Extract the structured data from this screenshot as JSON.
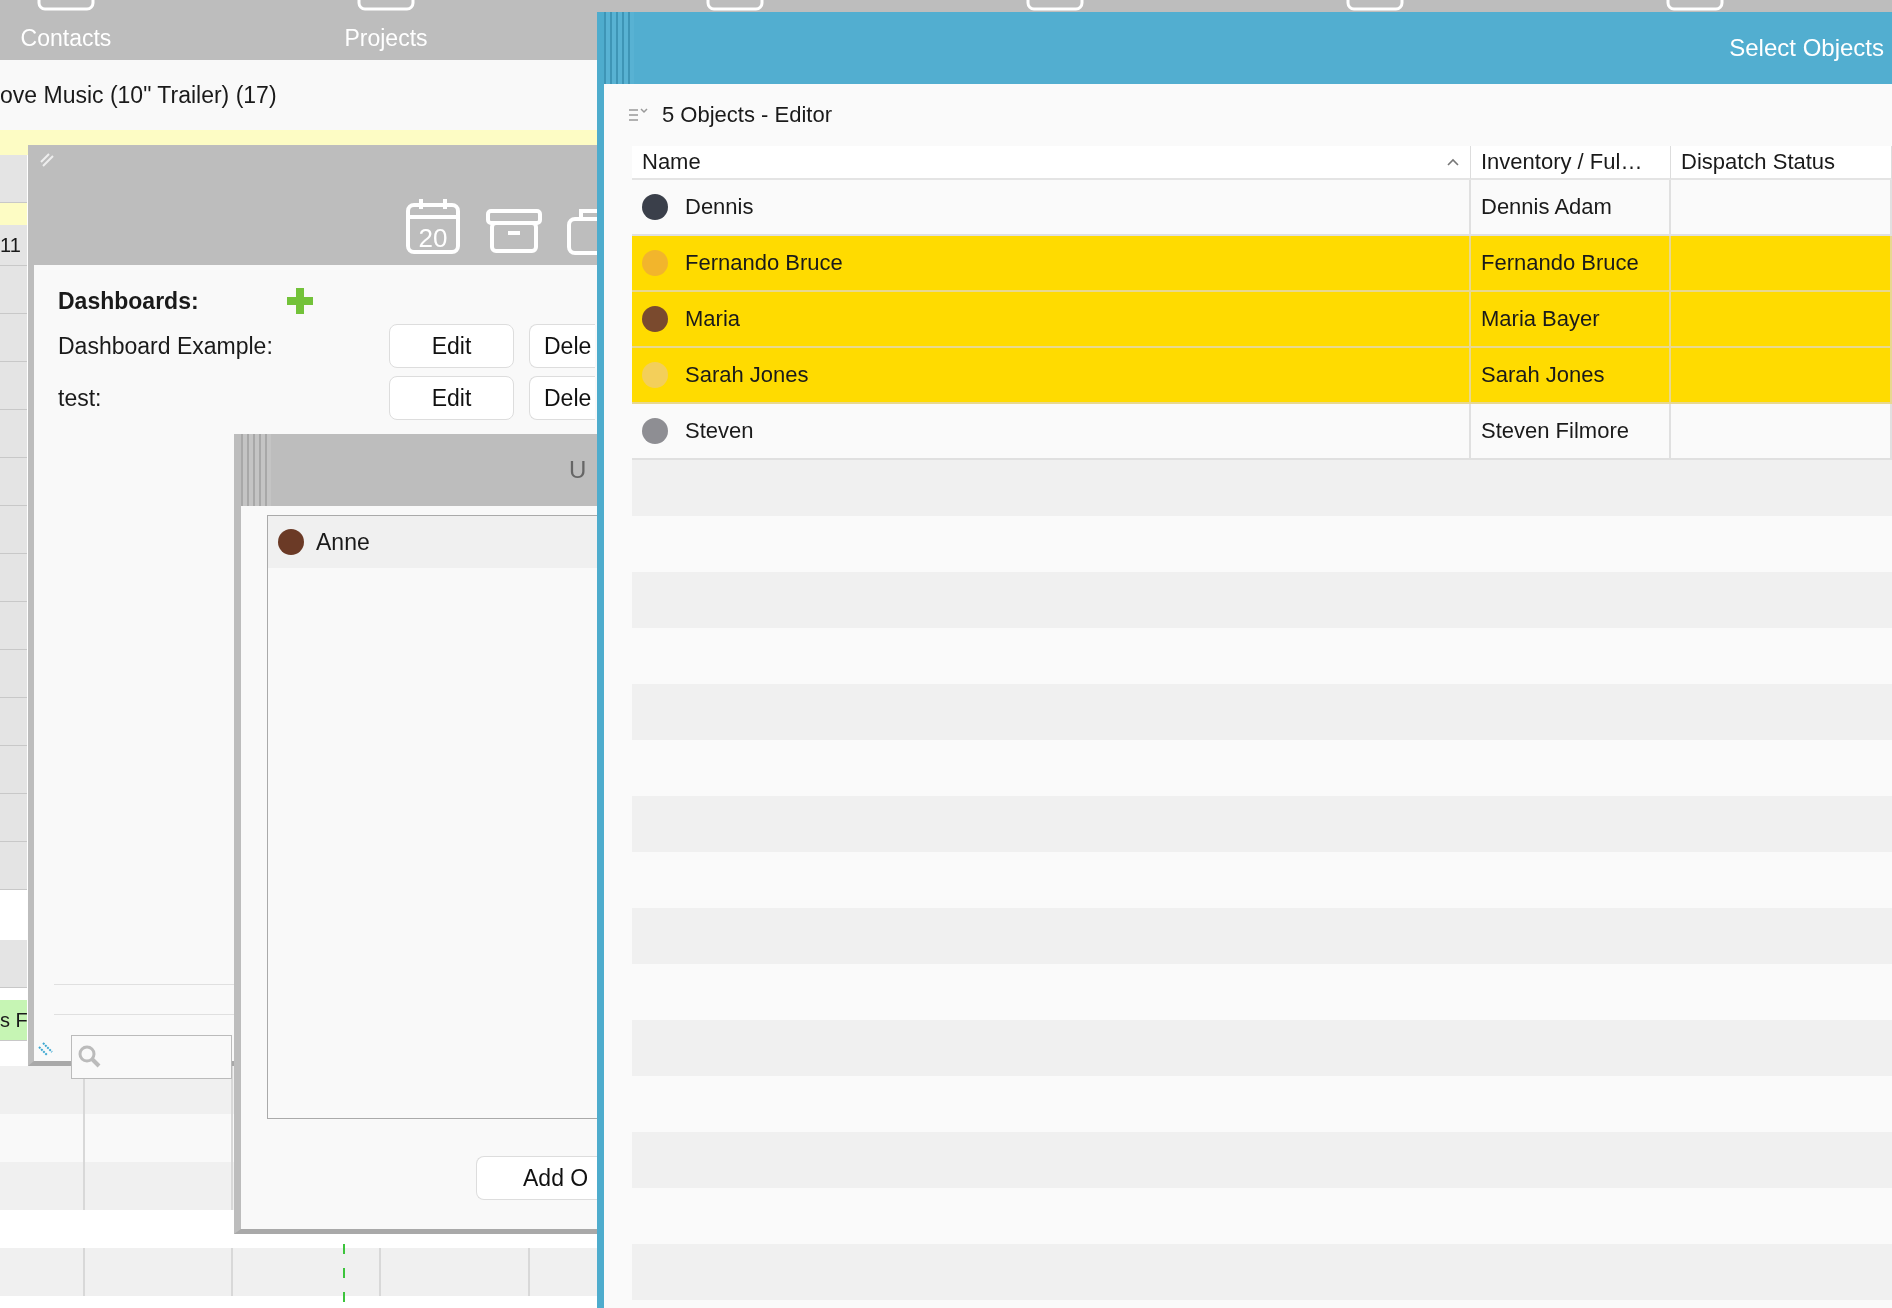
{
  "app_bar": {
    "nav": [
      {
        "label": "Contacts"
      },
      {
        "label": "Projects"
      }
    ]
  },
  "background": {
    "heading": "ove Music (10\" Trailer) (17)",
    "side_cells": [
      {
        "text": "11",
        "kind": "plain"
      },
      {
        "text": "s F",
        "kind": "green"
      }
    ]
  },
  "dashboards_window": {
    "calendar_day": "20",
    "title": "Dashboards:",
    "items": [
      {
        "label": "Dashboard Example:",
        "buttons": [
          "Edit",
          "Dele"
        ]
      },
      {
        "label": "test:",
        "buttons": [
          "Edit",
          "Dele"
        ]
      }
    ]
  },
  "objects_window": {
    "title": "U",
    "list": [
      {
        "name": "Anne",
        "color": "#6b3a26"
      }
    ],
    "button": "Add O"
  },
  "select_window": {
    "title": "Select Objects",
    "subtitle": "5 Objects - Editor",
    "columns": [
      {
        "label": "Name",
        "sorted": true
      },
      {
        "label": "Inventory / Ful…",
        "sorted": false
      },
      {
        "label": "Dispatch Status",
        "sorted": false
      }
    ],
    "rows": [
      {
        "name": "Dennis",
        "column_2": "Dennis Adam",
        "selected": false,
        "color": "#3a3f4a"
      },
      {
        "name": "Fernando Bruce",
        "column_2": "Fernando Bruce",
        "selected": true,
        "color": "#f2b52c"
      },
      {
        "name": "Maria",
        "column_2": "Maria Bayer",
        "selected": true,
        "color": "#7a4a2e"
      },
      {
        "name": "Sarah Jones",
        "column_2": "Sarah Jones",
        "selected": true,
        "color": "#f3cf5a"
      },
      {
        "name": "Steven",
        "column_2": "Steven Filmore",
        "selected": false,
        "color": "#8e8e93"
      }
    ]
  }
}
